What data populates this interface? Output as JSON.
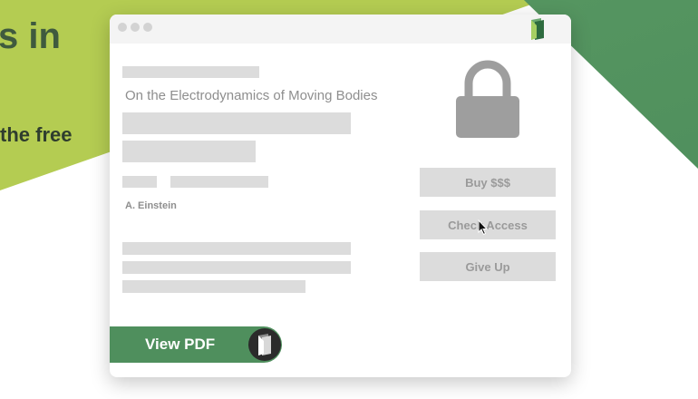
{
  "background": {
    "headline_fragment": "s in",
    "subline_fragment": "the free",
    "colors": {
      "lime": "#b4cc52",
      "green": "#4f8f5d"
    }
  },
  "window": {
    "title_dots": [
      "close-dot",
      "minimize-dot",
      "zoom-dot"
    ],
    "brand_icon": "bookmark-logo-icon"
  },
  "paper": {
    "title": "On the Electrodynamics of Moving Bodies",
    "author": "A. Einstein"
  },
  "paywall": {
    "icon": "padlock-icon",
    "buttons": {
      "buy": "Buy $$$",
      "check": "Check Access",
      "giveup": "Give Up"
    }
  },
  "pdf_button": {
    "label": "View PDF",
    "icon": "bookmark-logo-icon"
  },
  "colors": {
    "placeholder": "#dcdcdc",
    "muted_text": "#8e8e8e",
    "lock": "#9e9e9e"
  }
}
